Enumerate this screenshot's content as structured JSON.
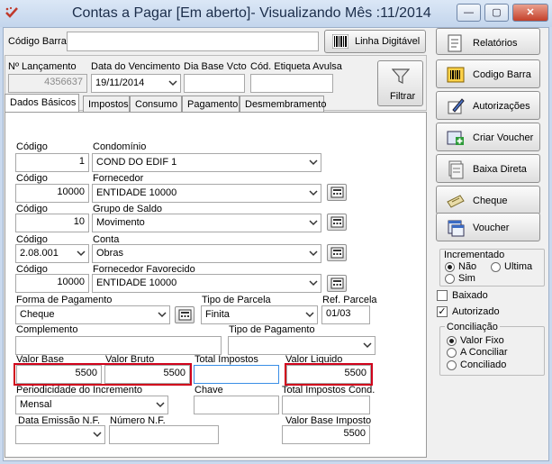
{
  "window": {
    "title": "Contas a Pagar [Em aberto]- Visualizando Mês :11/2014",
    "minimize": "—",
    "maximize": "▢",
    "close": "✕"
  },
  "barcode": {
    "label": "Código Barra",
    "value": "",
    "button": "Linha Digitável"
  },
  "header": {
    "lancamento_label": "Nº Lançamento",
    "lancamento_value": "4356637",
    "vencimento_label": "Data do Vencimento",
    "vencimento_value": "19/11/2014",
    "dia_base_label": "Dia Base Vcto",
    "dia_base_value": "",
    "etiqueta_label": "Cód. Etiqueta Avulsa",
    "etiqueta_value": "",
    "filtrar": "Filtrar"
  },
  "tabs": [
    "Dados Básicos",
    "Impostos",
    "Consumo",
    "Pagamento",
    "Desmembramento"
  ],
  "form": {
    "codigo_label": "Código",
    "condominio_label": "Condomínio",
    "condominio_code": "1",
    "condominio_value": "COND DO EDIF 1",
    "fornecedor_label": "Fornecedor",
    "fornecedor_code": "10000",
    "fornecedor_value": "ENTIDADE 10000",
    "grupo_label": "Grupo de Saldo",
    "grupo_code": "10",
    "grupo_value": "Movimento",
    "conta_label": "Conta",
    "conta_code": "2.08.001",
    "conta_value": "Obras",
    "favorecido_label": "Fornecedor Favorecido",
    "favorecido_code": "10000",
    "favorecido_value": "ENTIDADE 10000",
    "forma_label": "Forma de Pagamento",
    "forma_value": "Cheque",
    "tipo_parcela_label": "Tipo de Parcela",
    "tipo_parcela_value": "Finita",
    "ref_parcela_label": "Ref. Parcela",
    "ref_parcela_value": "01/03",
    "complemento_label": "Complemento",
    "complemento_value": "",
    "tipo_pagamento_label": "Tipo de Pagamento",
    "tipo_pagamento_value": "",
    "valor_base_label": "Valor Base",
    "valor_base_value": "5500",
    "valor_bruto_label": "Valor Bruto",
    "valor_bruto_value": "5500",
    "total_impostos_label": "Total Impostos",
    "total_impostos_value": "",
    "valor_liquido_label": "Valor Liquido",
    "valor_liquido_value": "5500",
    "periodicidade_label": "Periodicidade do Incremento",
    "periodicidade_value": "Mensal",
    "chave_label": "Chave",
    "chave_value": "",
    "total_impostos_cond_label": "Total Impostos Cond.",
    "total_impostos_cond_value": "",
    "data_emissao_label": "Data Emissão N.F.",
    "data_emissao_value": "",
    "numero_nf_label": "Número N.F.",
    "numero_nf_value": "",
    "valor_base_imposto_label": "Valor Base Imposto",
    "valor_base_imposto_value": "5500"
  },
  "sidebar": {
    "relatorios": "Relatórios",
    "codigo_barra": "Codigo Barra",
    "autorizacoes": "Autorizações",
    "criar_voucher": "Criar Voucher",
    "baixa_direta": "Baixa Direta",
    "cheque": "Cheque",
    "voucher": "Voucher"
  },
  "incrementado": {
    "label": "Incrementado",
    "nao": "Não",
    "ultima": "Ultima",
    "sim": "Sim",
    "selected": "Não"
  },
  "flags": {
    "baixado": "Baixado",
    "baixado_checked": false,
    "autorizado": "Autorizado",
    "autorizado_checked": true
  },
  "conciliacao": {
    "label": "Conciliação",
    "valor_fixo": "Valor Fixo",
    "a_conciliar": "A Conciliar",
    "conciliado": "Conciliado",
    "selected": "Valor Fixo"
  },
  "colors": {
    "highlight_border": "#d0021b",
    "title_text": "#1b2d4a",
    "window_frame": "#c9d9ee"
  }
}
